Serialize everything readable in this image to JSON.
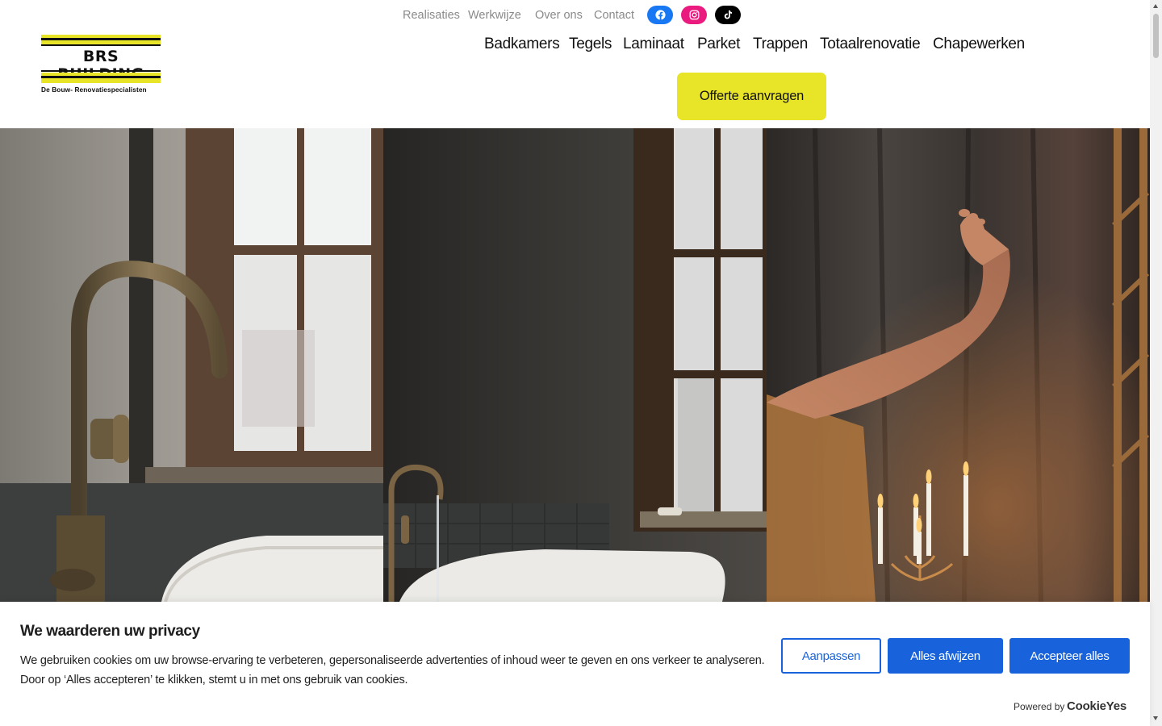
{
  "logo": {
    "name": "BRS BUILDING",
    "tagline": "De Bouw- Renovatiespecialisten",
    "colors": {
      "yellow": "#e8e427",
      "black": "#111111"
    }
  },
  "top_nav": [
    {
      "label": "Realisaties"
    },
    {
      "label": "Werkwijze"
    },
    {
      "label": "Over ons"
    },
    {
      "label": "Contact"
    }
  ],
  "social": [
    {
      "icon": "facebook-icon",
      "color": "#1877f2"
    },
    {
      "icon": "instagram-icon",
      "color": "#ea1a7f"
    },
    {
      "icon": "tiktok-icon",
      "color": "#000000"
    }
  ],
  "main_nav": [
    {
      "label": "Badkamers"
    },
    {
      "label": "Tegels"
    },
    {
      "label": "Laminaat"
    },
    {
      "label": "Parket"
    },
    {
      "label": "Trappen"
    },
    {
      "label": "Totaalrenovatie"
    },
    {
      "label": "Chapewerken"
    }
  ],
  "cta": {
    "label": "Offerte aanvragen",
    "color": "#e8e427"
  },
  "hero": {
    "photos": [
      {
        "subject": "brass-faucet-bathtub-photo"
      },
      {
        "subject": "bathtub-window-photo"
      },
      {
        "subject": "bath-candles-photo"
      }
    ]
  },
  "cookie_banner": {
    "title": "We waarderen uw privacy",
    "text": "We gebruiken cookies om uw browse-ervaring te verbeteren, gepersonaliseerde advertenties of inhoud weer te geven en ons verkeer te analyseren. Door op ‘Alles accepteren’ te klikken, stemt u in met ons gebruik van cookies.",
    "buttons": {
      "customize": "Aanpassen",
      "reject": "Alles afwijzen",
      "accept": "Accepteer alles"
    },
    "powered_by": "Powered by",
    "brand": "CookieYes",
    "accent": "#1863dc"
  }
}
